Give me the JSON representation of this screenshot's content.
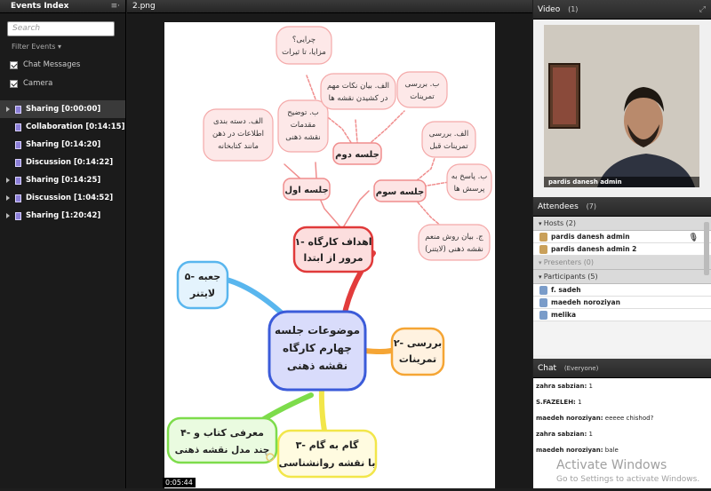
{
  "events_panel": {
    "title": "Events Index",
    "menu_icon": "≡·",
    "search_placeholder": "Search",
    "filter_label": "Filter Events ▾",
    "checks": [
      {
        "label": "Chat Messages"
      },
      {
        "label": "Camera"
      }
    ],
    "events": [
      {
        "label": "Sharing [0:00:00]",
        "selected": true
      },
      {
        "label": "Collaboration [0:14:15]"
      },
      {
        "label": "Sharing [0:14:20]"
      },
      {
        "label": "Discussion [0:14:22]"
      },
      {
        "label": "Sharing [0:14:25]"
      },
      {
        "label": "Discussion [1:04:52]"
      },
      {
        "label": "Sharing [1:20:42]"
      }
    ]
  },
  "share": {
    "title": "2.png",
    "timestamp": "0:05:44"
  },
  "mindmap": {
    "center": [
      "موضوعات جلسه",
      "چهارم کارگاه",
      "نقشه ذهنی"
    ],
    "b1": [
      "۱- اهداف کارگاه",
      "مرور از ابتدا"
    ],
    "b2": [
      "۲- بررسی",
      "تمرینات"
    ],
    "b3": [
      "۳- گام به گام",
      "با نقشه روانشناسی"
    ],
    "b4": [
      "۴- معرفی کتاب و",
      "چند مدل نقشه ذهنی"
    ],
    "b5": [
      "۵- جعبه",
      "لایتنر"
    ],
    "s1": "جلسه اول",
    "s2": "جلسه دوم",
    "s3": "جلسه سوم",
    "n1": [
      "الف. دسته بندی",
      "اطلاعات در ذهن",
      "مانند کتابخانه"
    ],
    "n2": [
      "ب. توضیح",
      "مقدمات",
      "نقشه ذهنی"
    ],
    "n3": [
      "چرایی؟",
      "مزایا، تا ثیرات"
    ],
    "n4": [
      "الف. بیان نکات مهم",
      "در کشیدن نقشه ها"
    ],
    "n5": [
      "ب. بررسی",
      "تمرینات"
    ],
    "n6": [
      "الف. بررسی",
      "تمرینات قبل"
    ],
    "n7": [
      "ب. پاسخ به",
      "پرسش ها"
    ],
    "n8": [
      "ج. بیان روش منعم",
      "نقشه ذهنی (لایتنر)"
    ]
  },
  "video": {
    "title": "Video",
    "count": "(1)",
    "name": "pardis danesh admin"
  },
  "attendees": {
    "title": "Attendees",
    "count": "(7)",
    "hosts_label": "Hosts (2)",
    "hosts": [
      "pardis danesh admin",
      "pardis danesh admin 2"
    ],
    "presenters_label": "Presenters (0)",
    "participants_label": "Participants (5)",
    "participants": [
      "f. sadeh",
      "maedeh noroziyan",
      "melika"
    ]
  },
  "chat": {
    "title": "Chat",
    "audience": "(Everyone)",
    "messages": [
      {
        "author": "zahra  sabzian:",
        "text": " 1"
      },
      {
        "author": "S.FAZELEH:",
        "text": " 1"
      },
      {
        "author": "maedeh noroziyan:",
        "text": " eeeee chishod?"
      },
      {
        "author": "zahra  sabzian:",
        "text": " 1"
      },
      {
        "author": "maedeh noroziyan:",
        "text": " bale"
      }
    ],
    "watermark_title": "Activate Windows",
    "watermark_sub": "Go to Settings to activate Windows."
  }
}
